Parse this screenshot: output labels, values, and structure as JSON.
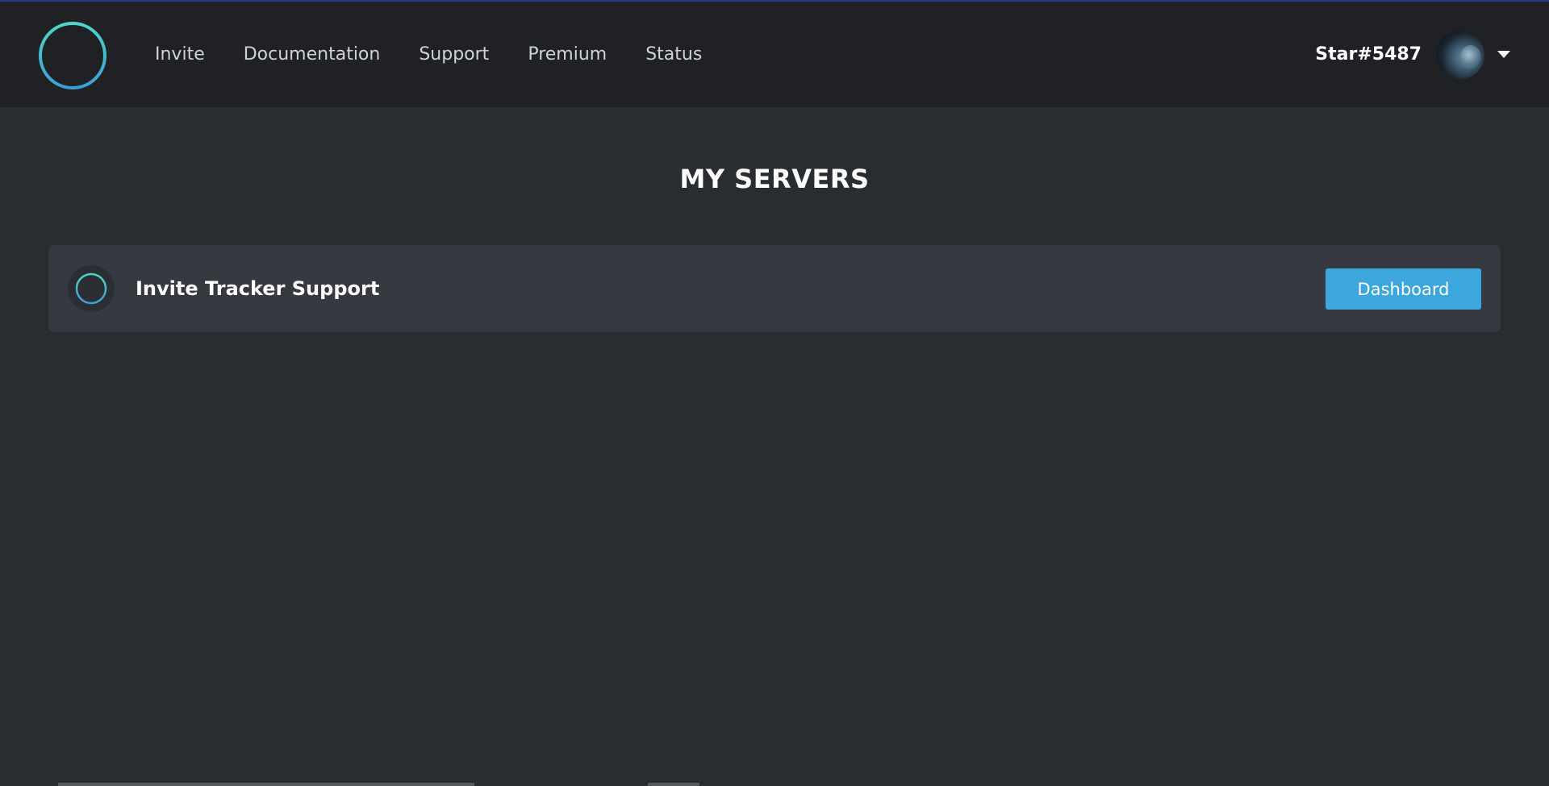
{
  "nav": {
    "logo_icon": "plus-circle-icon",
    "links": [
      {
        "label": "Invite"
      },
      {
        "label": "Documentation"
      },
      {
        "label": "Support"
      },
      {
        "label": "Premium"
      },
      {
        "label": "Status"
      }
    ],
    "user": {
      "username": "Star#5487",
      "avatar_icon": "avatar",
      "dropdown_icon": "caret-down-icon"
    }
  },
  "main": {
    "title": "MY SERVERS",
    "servers": [
      {
        "icon": "plus-circle-icon",
        "name": "Invite Tracker Support",
        "action_label": "Dashboard"
      }
    ]
  },
  "colors": {
    "accent": "#3ba7de",
    "logo_gradient_start": "#4fd6c8",
    "logo_gradient_end": "#3a9fd8",
    "navbar_bg": "#1f2124",
    "page_bg": "#292c30",
    "card_bg": "#36393f"
  }
}
